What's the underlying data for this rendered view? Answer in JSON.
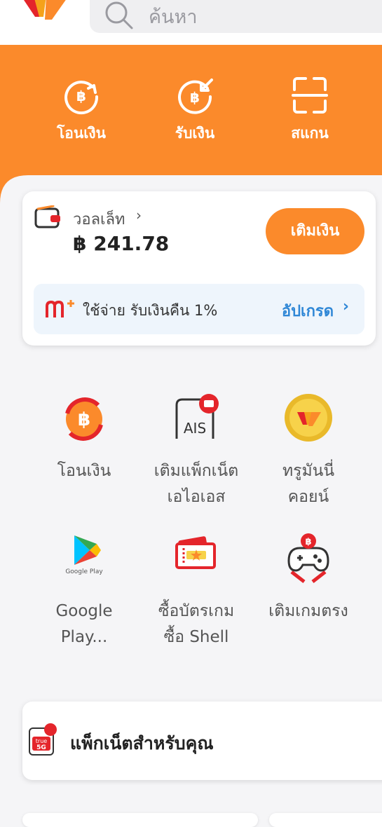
{
  "search": {
    "placeholder": "ค้นหา"
  },
  "quick_actions": [
    {
      "label": "โอนเงิน",
      "icon": "transfer-icon"
    },
    {
      "label": "รับเงิน",
      "icon": "receive-icon"
    },
    {
      "label": "สแกน",
      "icon": "scan-icon"
    }
  ],
  "wallet": {
    "name": "วอลเล็ท",
    "balance": "฿ 241.78",
    "topup_label": "เติมเงิน",
    "promo_text": "ใช้จ่าย รับเงินคืน 1%",
    "upgrade_label": "อัปเกรด"
  },
  "services": [
    {
      "label_line1": "โอนเงิน",
      "label_line2": "",
      "icon": "baht-transfer-icon"
    },
    {
      "label_line1": "เติมแพ็กเน็ต",
      "label_line2": "เอไอเอส",
      "icon": "ais-sim-icon"
    },
    {
      "label_line1": "ทรูมันนี่",
      "label_line2": "คอยน์",
      "icon": "truemoney-coin-icon"
    },
    {
      "label_line1": "Google",
      "label_line2": "Play...",
      "icon": "google-play-icon"
    },
    {
      "label_line1": "ซื้อบัตรเกม",
      "label_line2": "ซื้อ Shell",
      "icon": "game-ticket-icon"
    },
    {
      "label_line1": "เติมเกมตรง",
      "label_line2": "",
      "icon": "game-controller-icon"
    }
  ],
  "packages": {
    "title": "แพ็กเน็ตสำหรับคุณ",
    "icon": "true-5g-icon"
  },
  "colors": {
    "brand_orange": "#fb8a2b",
    "link_blue": "#2f87d6"
  }
}
